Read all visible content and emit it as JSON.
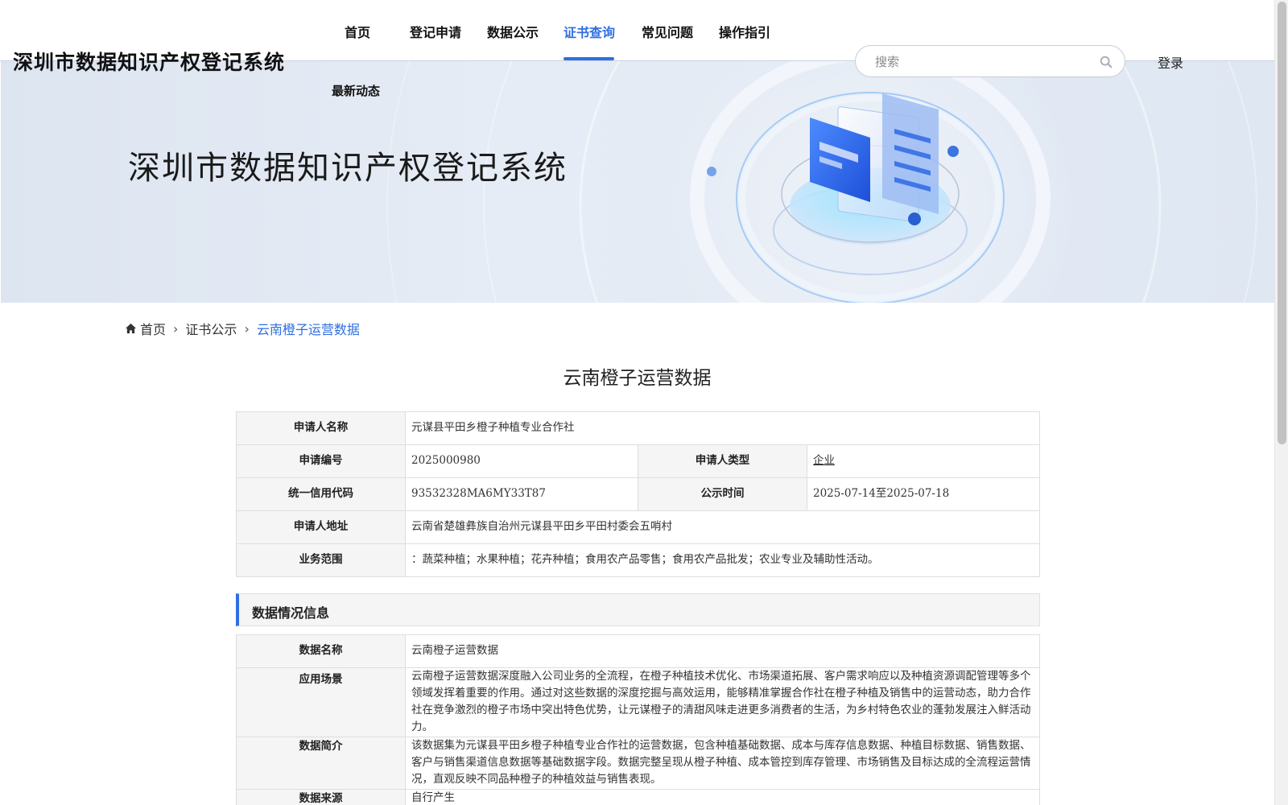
{
  "site_title": "深圳市数据知识产权登记系统",
  "nav": {
    "items": [
      {
        "label": "首页"
      },
      {
        "label": "登记申请"
      },
      {
        "label": "数据公示"
      },
      {
        "label": "证书查询"
      },
      {
        "label": "常见问题"
      },
      {
        "label": "操作指引"
      },
      {
        "label": "最新动态"
      }
    ],
    "active": "证书查询"
  },
  "search": {
    "placeholder": "搜索"
  },
  "login_label": "登录",
  "banner": {
    "title": "深圳市数据知识产权登记系统"
  },
  "breadcrumb": {
    "home": "首页",
    "level1": "证书公示",
    "current": "云南橙子运营数据"
  },
  "page_title": "云南橙子运营数据",
  "applicant": {
    "name_label": "申请人名称",
    "name": "元谋县平田乡橙子种植专业合作社",
    "number_label": "申请编号",
    "number": "2025000980",
    "type_label": "申请人类型",
    "type": "企业",
    "credit_label": "统一信用代码",
    "credit": "93532328MA6MY33T87",
    "publish_label": "公示时间",
    "publish": "2025-07-14至2025-07-18",
    "address_label": "申请人地址",
    "address": "云南省楚雄彝族自治州元谋县平田乡平田村委会五哨村",
    "scope_label": "业务范围",
    "scope": "：蔬菜种植；水果种植；花卉种植；食用农产品零售；食用农产品批发；农业专业及辅助性活动。"
  },
  "section_title": "数据情况信息",
  "data_info": {
    "name_label": "数据名称",
    "name": "云南橙子运营数据",
    "scene_label": "应用场景",
    "scene": "云南橙子运营数据深度融入公司业务的全流程，在橙子种植技术优化、市场渠道拓展、客户需求响应以及种植资源调配管理等多个领域发挥着重要的作用。通过对这些数据的深度挖掘与高效运用，能够精准掌握合作社在橙子种植及销售中的运营动态，助力合作社在竞争激烈的橙子市场中突出特色优势，让元谋橙子的清甜风味走进更多消费者的生活，为乡村特色农业的蓬勃发展注入鲜活动力。",
    "intro_label": "数据简介",
    "intro": "该数据集为元谋县平田乡橙子种植专业合作社的运营数据，包含种植基础数据、成本与库存信息数据、种植目标数据、销售数据、客户与销售渠道信息数据等基础数据字段。数据完整呈现从橙子种植、成本管控到库存管理、市场销售及目标达成的全流程运营情况，直观反映不同品种橙子的种植效益与销售表现。",
    "source_label": "数据来源",
    "source": "自行产生"
  },
  "colors": {
    "accent": "#2f6fe0",
    "label_bg": "#f5f5f5",
    "banner_bg": "#dde5f1"
  }
}
